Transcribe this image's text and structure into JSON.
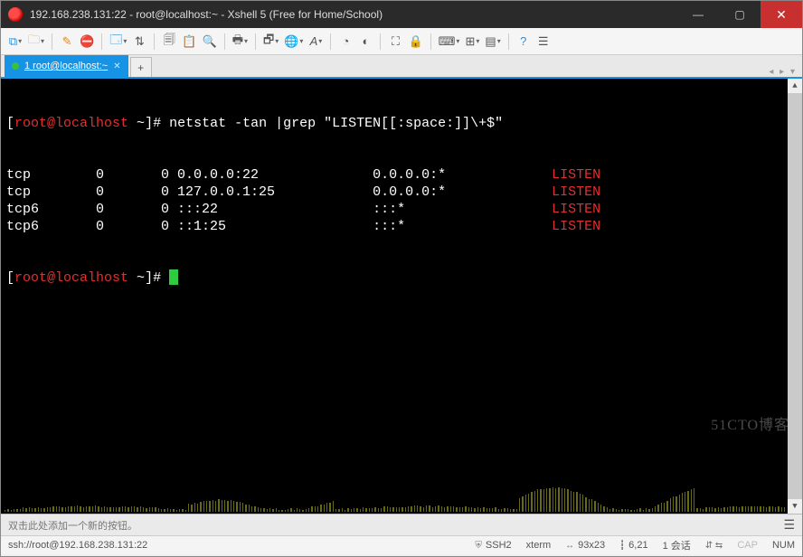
{
  "window": {
    "title": "192.168.238.131:22 - root@localhost:~ - Xshell 5 (Free for Home/School)",
    "min": "—",
    "max": "▢",
    "close": "✕"
  },
  "tabs": {
    "active": {
      "label": "1 root@localhost:~"
    },
    "add": "+",
    "nav_left": "◂",
    "nav_right": "▸",
    "nav_menu": "▾"
  },
  "terminal": {
    "prompt": {
      "open": "[",
      "user": "root@localhost",
      "path": " ~",
      "close": "]# "
    },
    "command": "netstat -tan |grep \"LISTEN[[:space:]]\\+$\"",
    "rows": [
      {
        "proto": "tcp",
        "recvq": "0",
        "sendq": "0",
        "local": "0.0.0.0:22",
        "foreign": "0.0.0.0:*",
        "state": "LISTEN"
      },
      {
        "proto": "tcp",
        "recvq": "0",
        "sendq": "0",
        "local": "127.0.0.1:25",
        "foreign": "0.0.0.0:*",
        "state": "LISTEN"
      },
      {
        "proto": "tcp6",
        "recvq": "0",
        "sendq": "0",
        "local": ":::22",
        "foreign": ":::*",
        "state": "LISTEN"
      },
      {
        "proto": "tcp6",
        "recvq": "0",
        "sendq": "0",
        "local": "::1:25",
        "foreign": ":::*",
        "state": "LISTEN"
      }
    ]
  },
  "footer": {
    "hint": "双击此处添加一个新的按钮。",
    "conn": "ssh://root@192.168.238.131:22"
  },
  "status": {
    "ssh": "SSH2",
    "term": "xterm",
    "size": "93x23",
    "pos": "6,21",
    "sessions": "1 会话",
    "caps": "CAP",
    "num": "NUM"
  },
  "watermark": "51CTO博客"
}
